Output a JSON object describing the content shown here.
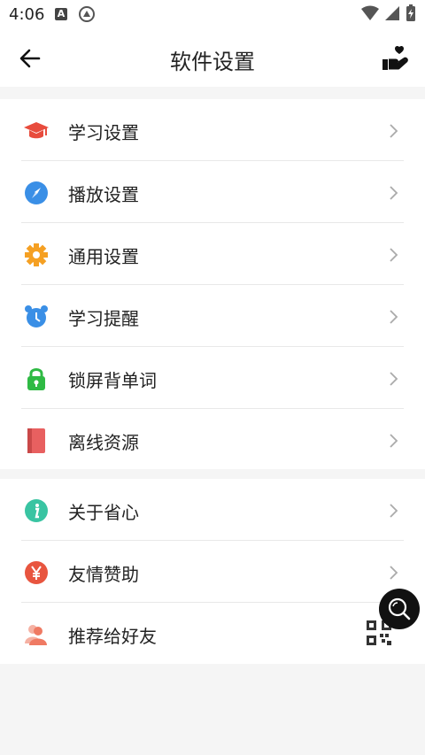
{
  "status": {
    "time": "4:06",
    "a_badge": "A"
  },
  "appbar": {
    "title": "软件设置"
  },
  "group1": [
    {
      "label": "学习设置",
      "icon": "graduation-cap-icon"
    },
    {
      "label": "播放设置",
      "icon": "compass-icon"
    },
    {
      "label": "通用设置",
      "icon": "gear-icon"
    },
    {
      "label": "学习提醒",
      "icon": "alarm-clock-icon"
    },
    {
      "label": "锁屏背单词",
      "icon": "lock-icon"
    },
    {
      "label": "离线资源",
      "icon": "book-icon"
    }
  ],
  "group2": [
    {
      "label": "关于省心",
      "icon": "info-icon"
    },
    {
      "label": "友情赞助",
      "icon": "yen-icon"
    },
    {
      "label": "推荐给好友",
      "icon": "people-icon"
    }
  ],
  "colors": {
    "cap": "#e84c3d",
    "compass": "#3a8fe6",
    "gear": "#f5a023",
    "alarm": "#3a8fe6",
    "lock": "#2fba44",
    "book": "#e86060",
    "info": "#39c4a2",
    "yen": "#e8553f",
    "people": "#ef7a63"
  }
}
